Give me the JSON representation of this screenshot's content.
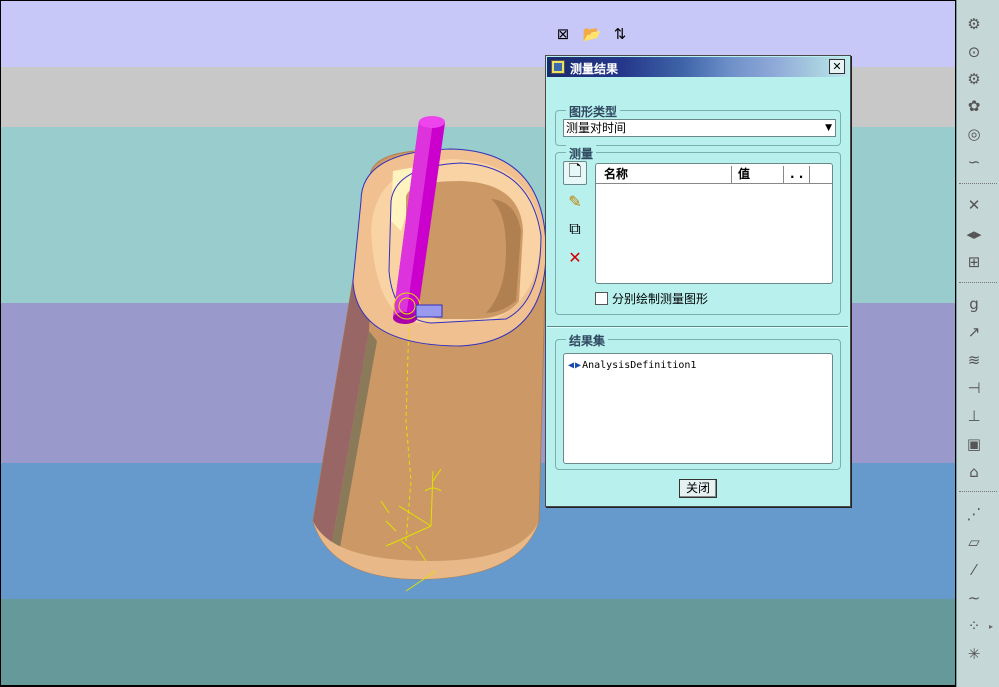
{
  "colors": {
    "background_bands": [
      "#c8c8f8",
      "#c8c8c8",
      "#99cccc",
      "#9999cc",
      "#6699cc",
      "#669999"
    ],
    "dialog_bg": "#b8f0ee",
    "model_body": "#cc9966",
    "pin": "#cc00cc",
    "toolbar_bg": "#c5d7d6"
  },
  "toolbar": {
    "icons": [
      "spring-icon",
      "motor-icon",
      "gear-pair-icon",
      "gear-icon",
      "cam-icon",
      "slot-icon",
      "mechanism-analysis-icon",
      "playback-icon",
      "measure-icon",
      "gravity-icon",
      "force-icon",
      "spring-element-icon",
      "damper-icon",
      "bushing-icon",
      "mass-properties-icon",
      "initial-condition-icon",
      "datum-icon",
      "plane-icon",
      "axis-icon",
      "curve-icon",
      "point-icon",
      "coordinate-system-icon"
    ]
  },
  "dialog": {
    "title": "测量结果",
    "chart_type_legend": "图形类型",
    "chart_type_value": "测量对时间",
    "measure_legend": "测量",
    "table_headers": [
      "名称",
      "值",
      ". ."
    ],
    "plot_separately_label": "分别绘制测量图形",
    "result_set_legend": "结果集",
    "result_item": "AnalysisDefinition1",
    "close_label": "关闭",
    "close_x": "✕"
  }
}
